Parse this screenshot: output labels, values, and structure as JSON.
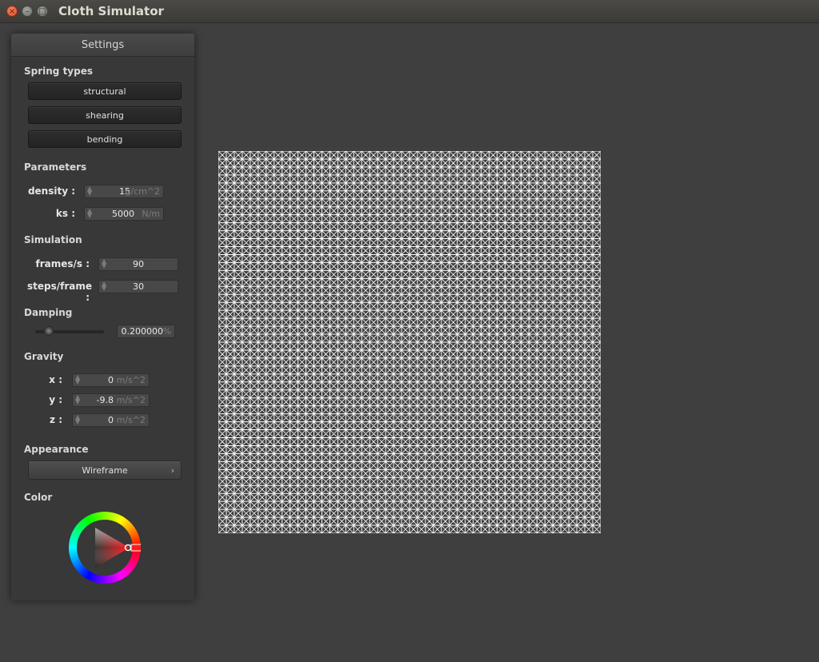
{
  "window": {
    "title": "Cloth Simulator",
    "buttons": [
      "close-icon",
      "minimize-icon",
      "maximize-icon"
    ]
  },
  "panel": {
    "title": "Settings",
    "spring_types": {
      "heading": "Spring types",
      "buttons": [
        "structural",
        "shearing",
        "bending"
      ]
    },
    "parameters": {
      "heading": "Parameters",
      "density": {
        "label": "density :",
        "value": "15",
        "unit": "g/cm^2"
      },
      "ks": {
        "label": "ks :",
        "value": "5000",
        "unit": "N/m"
      }
    },
    "simulation": {
      "heading": "Simulation",
      "fps": {
        "label": "frames/s :",
        "value": "90"
      },
      "steps": {
        "label": "steps/frame :",
        "value": "30"
      }
    },
    "damping": {
      "heading": "Damping",
      "value": "0.200000",
      "unit": "%",
      "slider_fraction": 0.2
    },
    "gravity": {
      "heading": "Gravity",
      "x": {
        "label": "x :",
        "value": "0",
        "unit": "m/s^2"
      },
      "y": {
        "label": "y :",
        "value": "-9.8",
        "unit": "m/s^2"
      },
      "z": {
        "label": "z :",
        "value": "0",
        "unit": "m/s^2"
      }
    },
    "appearance": {
      "heading": "Appearance",
      "selected": "Wireframe"
    },
    "color": {
      "heading": "Color",
      "selected_hex": "#ff0000"
    }
  },
  "viewport": {
    "mode": "wireframe",
    "grid_cells": 48,
    "line_color": "#ffffff",
    "background": "#3f3f3f"
  },
  "colors": {
    "window_bg": "#3f3f3f",
    "panel_bg": "#383838",
    "accent_close": "#dd4a20"
  }
}
